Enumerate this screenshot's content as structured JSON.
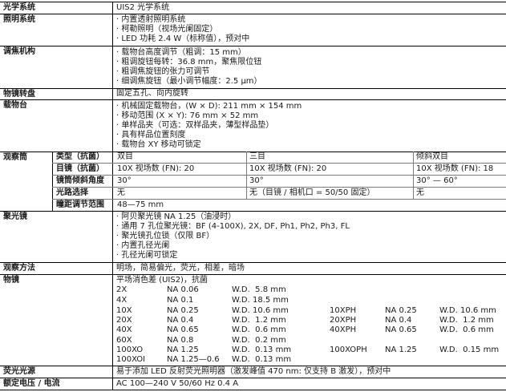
{
  "rows": {
    "optical": {
      "label": "光学系统",
      "value": "UIS2 光学系统"
    },
    "illum": {
      "label": "照明系统",
      "items": [
        "· 内置透射照明系统",
        "· 柯勒照明（视场光阑固定）",
        "· LED 功耗 2.4 W（标称值），预对中"
      ]
    },
    "focus": {
      "label": "调焦机构",
      "items": [
        "· 载物台高度调节（粗调：15 mm）",
        "· 粗调旋钮每转：36.8 mm，聚焦限位钮",
        "· 粗调焦旋钮的张力可调节",
        "· 细调焦旋钮（最小调节幅度：2.5 μm）"
      ]
    },
    "nosepiece": {
      "label": "物镜转盘",
      "value": "固定五孔、向内旋转"
    },
    "stage": {
      "label": "载物台",
      "items": [
        "· 机械固定载物台，(W × D): 211 mm × 154 mm",
        "· 移动范围 (X × Y): 76 mm × 52 mm",
        "· 单样品夹（可选：双样品夹，薄型样品垫）",
        "· 具有样品位置刻度",
        "· 载物台 XY 移动可锁定"
      ]
    },
    "observation": {
      "label": "观察筒",
      "sub": [
        "类型（抗菌）",
        "目镜（抗菌）",
        "镜筒倾斜角度",
        "光路选择",
        "瞳距调节范围"
      ],
      "col1": [
        "双目",
        "10X 视场数 (FN): 20",
        "30°",
        "无",
        "48—75 mm"
      ],
      "col2": [
        "三目",
        "10X 视场数 (FN): 20",
        "30°",
        "无（目镜 / 相机口 = 50/50 固定）"
      ],
      "col3": [
        "倾斜双目",
        "10X 视场数 (FN): 18",
        "30° — 60°",
        "无"
      ]
    },
    "condenser": {
      "label": "聚光镜",
      "items": [
        "· 阿贝聚光镜 NA 1.25（油浸时）",
        "· 通用 7 孔位聚光镜：BF (4-100X), 2X, DF, Ph1, Ph2, Ph3, FL",
        "· 聚光镜孔位锁（仅限 BF）",
        "· 内置孔径光阑",
        "· 孔径光阑可锁定"
      ]
    },
    "methods": {
      "label": "观察方法",
      "value": "明场，简易偏光，荧光，相差，暗场"
    },
    "objectives": {
      "label": "物镜",
      "heading": "平场消色差 (UIS2)，抗菌",
      "left": [
        {
          "mag": "2X",
          "na": "NA 0.06",
          "wd": "W.D.  5.8 mm"
        },
        {
          "mag": "4X",
          "na": "NA 0.1",
          "wd": "W.D. 18.5 mm"
        },
        {
          "mag": "10X",
          "na": "NA 0.25",
          "wd": "W.D. 10.6 mm"
        },
        {
          "mag": "20X",
          "na": "NA 0.4",
          "wd": "W.D.  1.2 mm"
        },
        {
          "mag": "40X",
          "na": "NA 0.65",
          "wd": "W.D.  0.6 mm"
        },
        {
          "mag": "60X",
          "na": "NA 0.8",
          "wd": "W.D.  0.2 mm"
        },
        {
          "mag": "100XO",
          "na": "NA 1.25",
          "wd": "W.D.  0.13 mm"
        },
        {
          "mag": "100XOI",
          "na": "NA 1.25—0.6",
          "wd": "W.D.  0.13 mm"
        }
      ],
      "right": [
        {
          "mag": "10XPH",
          "na": "NA 0.25",
          "wd": "W.D. 10.6 mm"
        },
        {
          "mag": "20XPH",
          "na": "NA 0.4",
          "wd": "W.D.  1.2 mm"
        },
        {
          "mag": "40XPH",
          "na": "NA 0.65",
          "wd": "W.D.  0.6 mm"
        },
        {
          "mag": "100XOPH",
          "na": "NA 1.25",
          "wd": "W.D.  0.15 mm"
        }
      ]
    },
    "fluor": {
      "label": "荧光光源",
      "value": "易于添加 LED 反射荧光照明器（激发峰值 470 nm: 仅支持 B 激发），预对中"
    },
    "power": {
      "label": "额定电压 / 电流",
      "value": "AC 100—240 V  50/60 Hz 0.4 A"
    }
  }
}
